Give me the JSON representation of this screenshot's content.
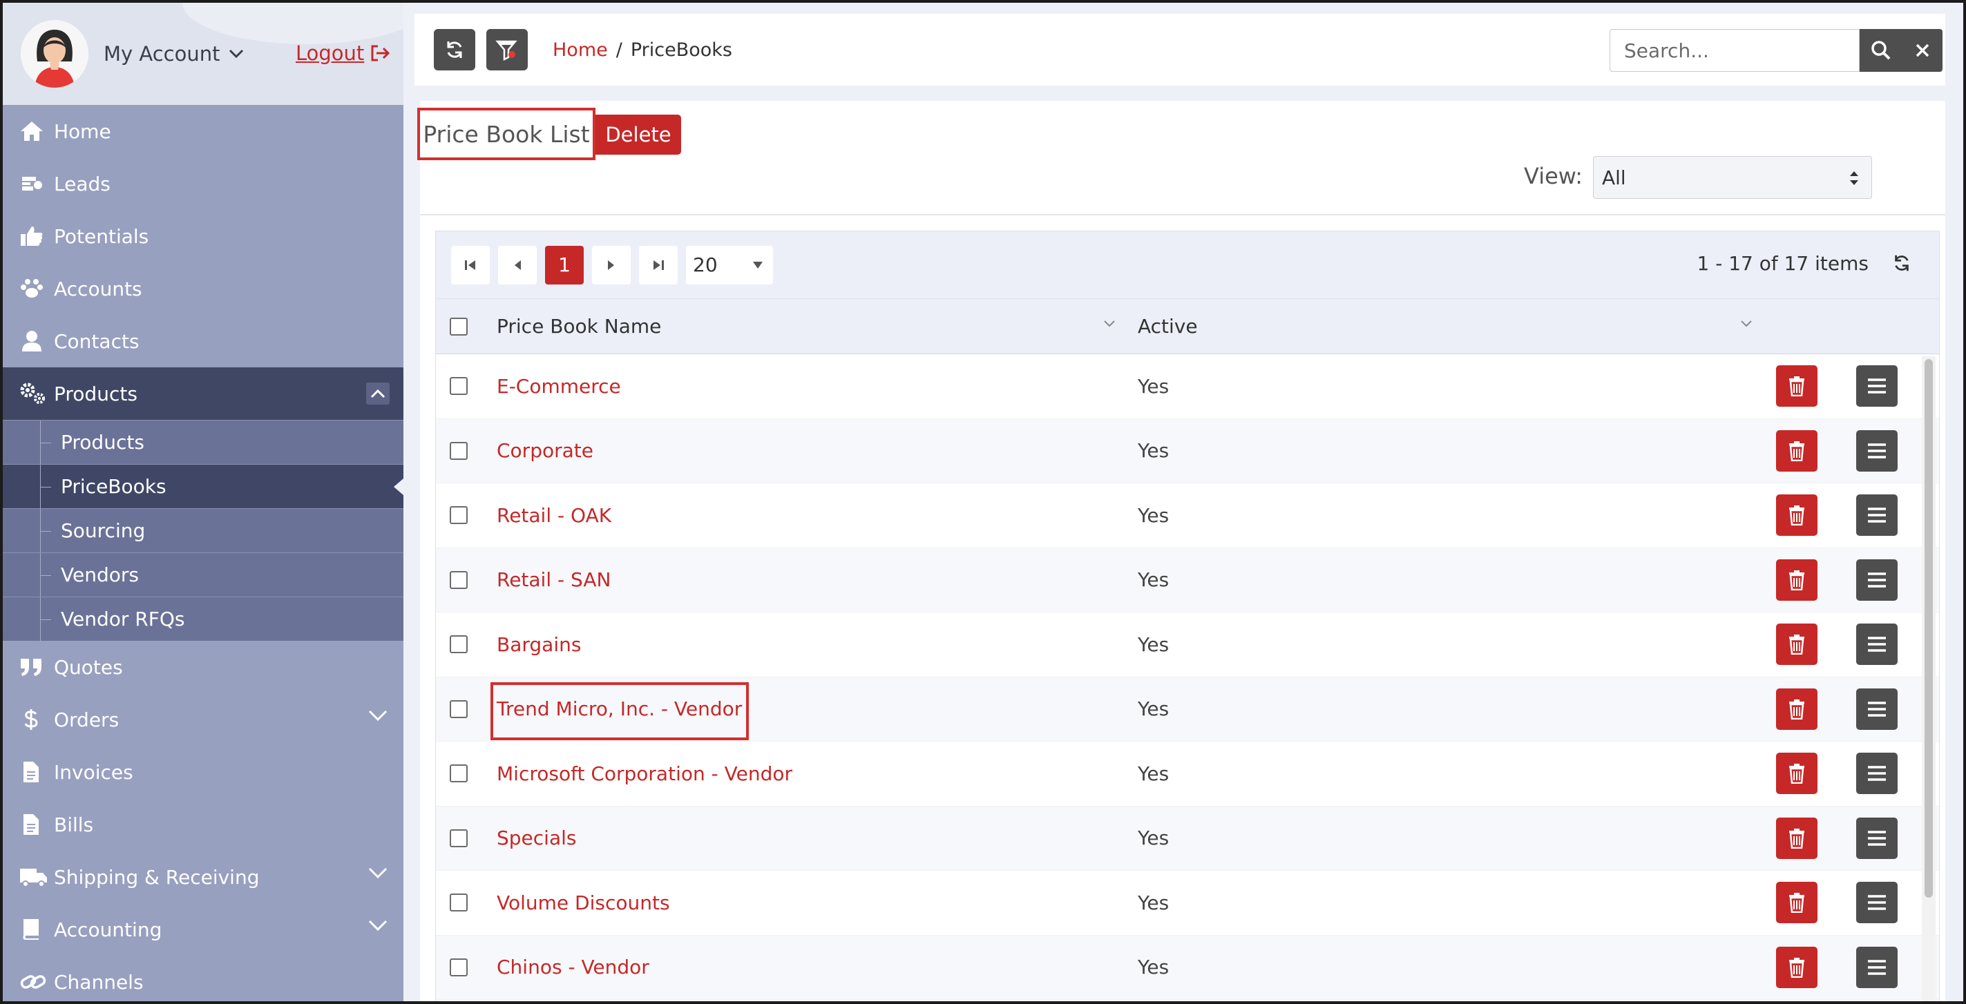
{
  "account": {
    "label": "My Account",
    "logout": "Logout"
  },
  "sidebar": {
    "items": [
      {
        "label": "Home",
        "icon": "home-icon"
      },
      {
        "label": "Leads",
        "icon": "leads-icon"
      },
      {
        "label": "Potentials",
        "icon": "thumbs-up-icon"
      },
      {
        "label": "Accounts",
        "icon": "paw-icon"
      },
      {
        "label": "Contacts",
        "icon": "user-icon"
      },
      {
        "label": "Products",
        "icon": "gears-icon"
      },
      {
        "label": "Quotes",
        "icon": "quote-icon"
      },
      {
        "label": "Orders",
        "icon": "dollar-icon"
      },
      {
        "label": "Invoices",
        "icon": "file-icon"
      },
      {
        "label": "Bills",
        "icon": "file-icon"
      },
      {
        "label": "Shipping & Receiving",
        "icon": "truck-icon"
      },
      {
        "label": "Accounting",
        "icon": "book-icon"
      },
      {
        "label": "Channels",
        "icon": "link-icon"
      }
    ],
    "products_sub": [
      "Products",
      "PriceBooks",
      "Sourcing",
      "Vendors",
      "Vendor RFQs"
    ]
  },
  "breadcrumb": {
    "home": "Home",
    "sep": "/",
    "current": "PriceBooks"
  },
  "search": {
    "placeholder": "Search..."
  },
  "page": {
    "title": "Price Book List",
    "delete": "Delete",
    "view_label": "View:",
    "view_value": "All"
  },
  "pager": {
    "current_page": "1",
    "page_size": "20",
    "items_info": "1 - 17 of 17 items"
  },
  "columns": {
    "name": "Price Book Name",
    "active": "Active"
  },
  "rows": [
    {
      "name": "E-Commerce",
      "active": "Yes"
    },
    {
      "name": "Corporate",
      "active": "Yes"
    },
    {
      "name": "Retail - OAK",
      "active": "Yes"
    },
    {
      "name": "Retail - SAN",
      "active": "Yes"
    },
    {
      "name": "Bargains",
      "active": "Yes"
    },
    {
      "name": "Trend Micro, Inc. - Vendor",
      "active": "Yes"
    },
    {
      "name": "Microsoft Corporation - Vendor",
      "active": "Yes"
    },
    {
      "name": "Specials",
      "active": "Yes"
    },
    {
      "name": "Volume Discounts",
      "active": "Yes"
    },
    {
      "name": "Chinos - Vendor",
      "active": "Yes"
    }
  ],
  "colors": {
    "accent": "#c62828",
    "sidebar": "#98a0bf",
    "sidebar_active": "#404765",
    "dark_button": "#4e4e4e"
  }
}
